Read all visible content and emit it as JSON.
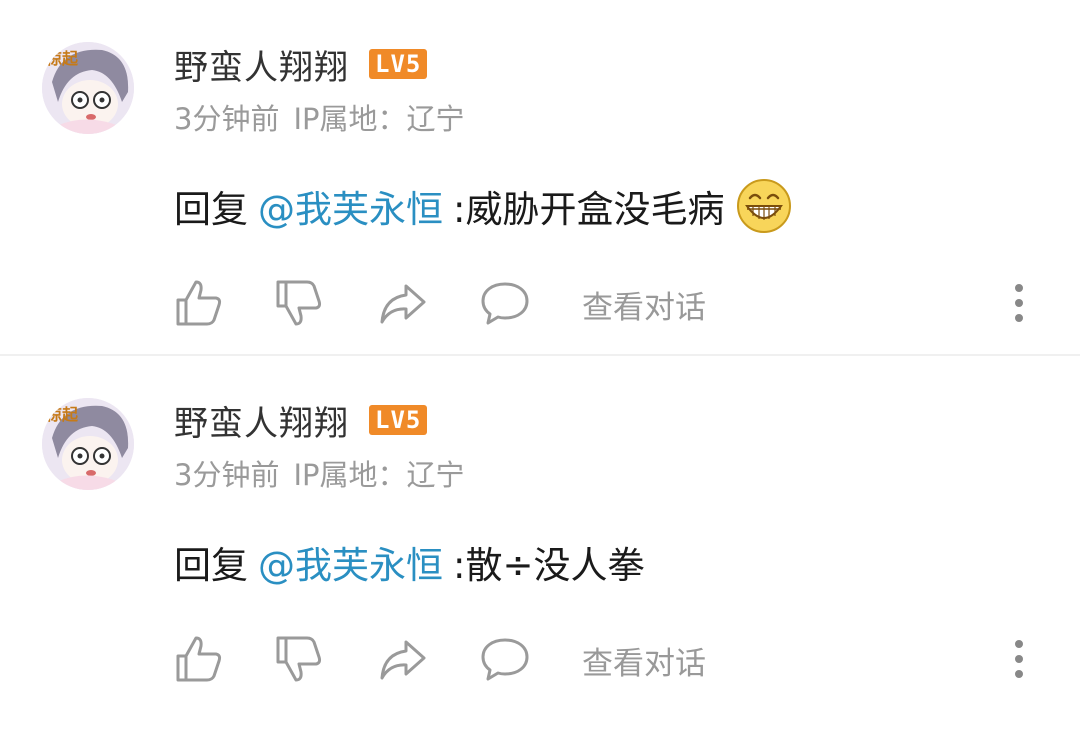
{
  "comments": [
    {
      "username": "野蛮人翔翔",
      "level": "LV5",
      "time": "3分钟前",
      "ip_location": "IP属地：辽宁",
      "reply_prefix": "回复",
      "mention": "@我芙永恒",
      "text": ":威胁开盒没毛病",
      "emoji": "grinning-face-emoji",
      "view_conversation": "查看对话"
    },
    {
      "username": "野蛮人翔翔",
      "level": "LV5",
      "time": "3分钟前",
      "ip_location": "IP属地：辽宁",
      "reply_prefix": "回复",
      "mention": "@我芙永恒",
      "text": ":散÷没人拳",
      "view_conversation": "查看对话"
    }
  ],
  "avatar_text": "惊起",
  "colors": {
    "mention": "#2a8fc2",
    "level_badge": "#f08a28",
    "meta": "#9a9a9a",
    "icon": "#9a9a9a"
  },
  "icons": [
    "thumbs-up-icon",
    "thumbs-down-icon",
    "share-icon",
    "comment-icon",
    "more-icon"
  ]
}
